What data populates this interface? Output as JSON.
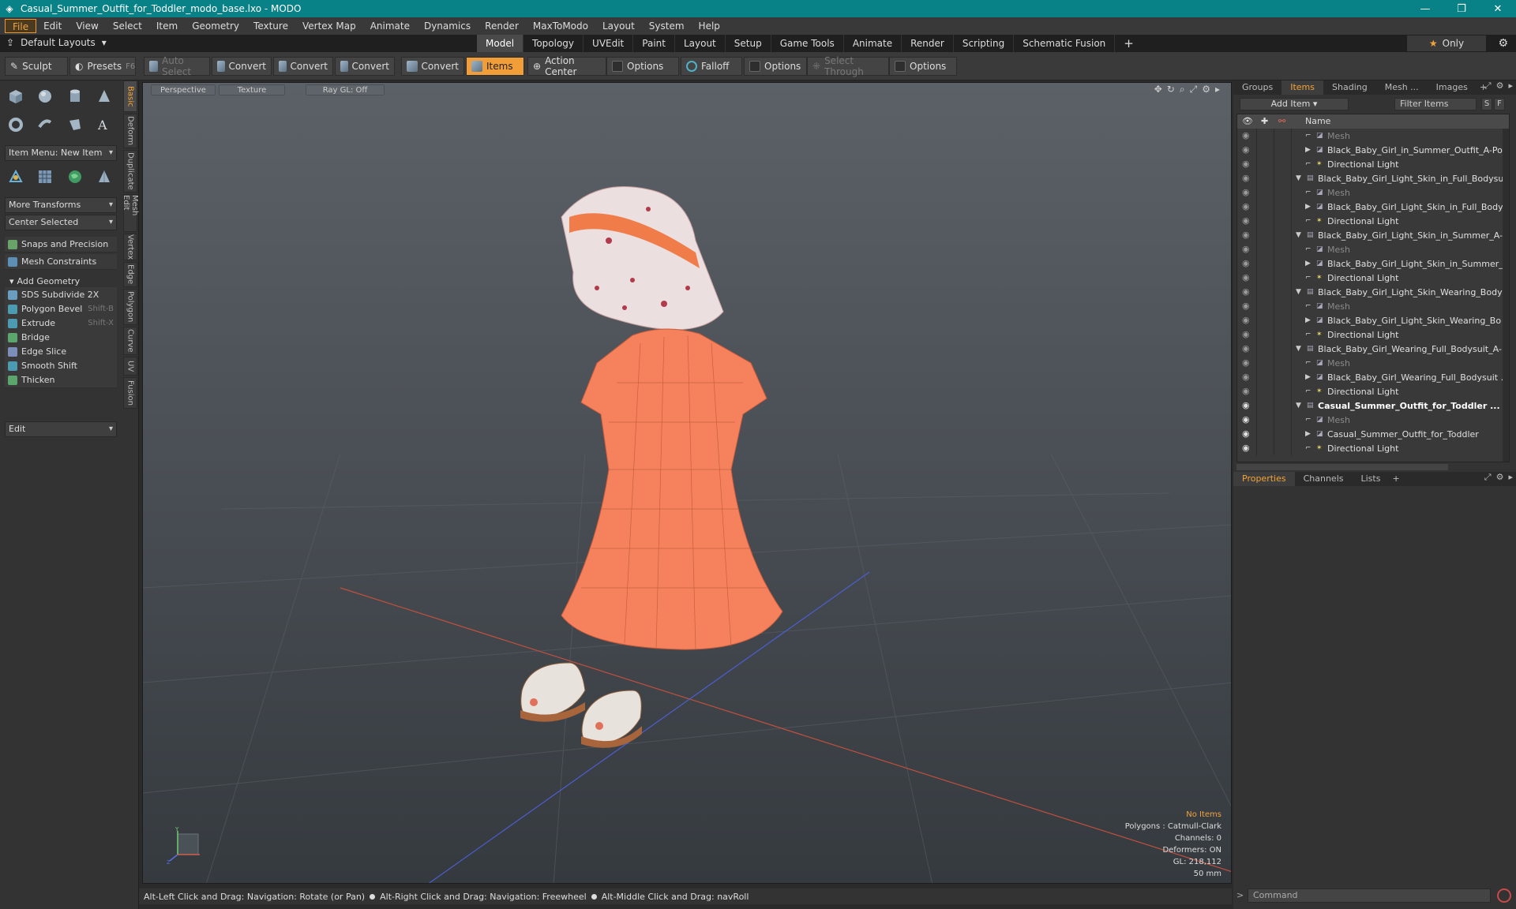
{
  "window": {
    "title": "Casual_Summer_Outfit_for_Toddler_modo_base.lxo - MODO",
    "controls": [
      "—",
      "❐",
      "✕"
    ]
  },
  "menu": [
    "File",
    "Edit",
    "View",
    "Select",
    "Item",
    "Geometry",
    "Texture",
    "Vertex Map",
    "Animate",
    "Dynamics",
    "Render",
    "MaxToModo",
    "Layout",
    "System",
    "Help"
  ],
  "layout_bar": {
    "layouts_label": "Default Layouts",
    "tabs": [
      "Model",
      "Topology",
      "UVEdit",
      "Paint",
      "Layout",
      "Setup",
      "Game Tools",
      "Animate",
      "Render",
      "Scripting",
      "Schematic Fusion",
      "+"
    ],
    "active_tab": "Model",
    "only_label": "Only"
  },
  "toolbar": {
    "sculpt": "Sculpt",
    "presets": "Presets",
    "presets_key": "F6",
    "auto_select": "Auto Select",
    "convert1": "Convert",
    "convert2": "Convert",
    "convert3": "Convert",
    "convert4": "Convert",
    "items": "Items",
    "action_center": "Action Center",
    "options1": "Options",
    "falloff": "Falloff",
    "options2": "Options",
    "select_through": "Select Through",
    "options3": "Options"
  },
  "left_panel": {
    "item_menu": "Item Menu: New Item",
    "more_transforms": "More Transforms",
    "center_selected": "Center Selected",
    "snaps": "Snaps and Precision",
    "mesh_constraints": "Mesh Constraints",
    "add_geometry": "Add Geometry",
    "tools": [
      {
        "label": "SDS Subdivide 2X",
        "key": "",
        "color": "#6a9ec0"
      },
      {
        "label": "Polygon Bevel",
        "key": "Shift-B",
        "color": "#4d9ab3"
      },
      {
        "label": "Extrude",
        "key": "Shift-X",
        "color": "#4d9ab3"
      },
      {
        "label": "Bridge",
        "key": "",
        "color": "#5aa66c"
      },
      {
        "label": "Edge Slice",
        "key": "",
        "color": "#7d8fb8"
      },
      {
        "label": "Smooth Shift",
        "key": "",
        "color": "#4d9ab3"
      },
      {
        "label": "Thicken",
        "key": "",
        "color": "#5aa66c"
      }
    ],
    "edit_dropdown": "Edit",
    "vtabs": [
      "Basic",
      "Deform",
      "Duplicate",
      "Mesh Edit",
      "Vertex",
      "Edge",
      "Polygon",
      "Curve",
      "UV",
      "Fusion"
    ]
  },
  "viewport": {
    "view_mode": "Perspective",
    "shading": "Texture",
    "raygl": "Ray GL: Off",
    "info": {
      "selection": "No Items",
      "polygons": "Polygons : Catmull-Clark",
      "channels": "Channels: 0",
      "deformers": "Deformers: ON",
      "gl": "GL: 218,112",
      "scale": "50 mm"
    },
    "colors": {
      "dress": "#f5825c",
      "hat_band": "#f07c4a",
      "hat": "#e9dede",
      "axis_x": "#c0503e",
      "axis_z": "#4c5ecf"
    }
  },
  "status_bar": [
    "Alt-Left Click and Drag: Navigation: Rotate (or Pan)",
    "Alt-Right Click and Drag: Navigation: Freewheel",
    "Alt-Middle Click and Drag: navRoll"
  ],
  "right_panel": {
    "top_tabs": [
      "Groups",
      "Items",
      "Shading",
      "Mesh ...",
      "Images",
      "+"
    ],
    "active_top": "Items",
    "add_item": "Add Item",
    "filter_items": "Filter Items",
    "filter_s": "S",
    "filter_f": "F",
    "tree_header": "Name",
    "tree": [
      {
        "label": "Mesh",
        "indent": 2,
        "arrow": "",
        "dim": true,
        "eye": false,
        "bold": false
      },
      {
        "label": "Black_Baby_Girl_in_Summer_Outfit_A-Pose",
        "indent": 2,
        "arrow": "▶",
        "dim": false,
        "eye": false,
        "bold": false
      },
      {
        "label": "Directional Light",
        "indent": 2,
        "arrow": "",
        "dim": false,
        "eye": false,
        "bold": false
      },
      {
        "label": "Black_Baby_Girl_Light_Skin_in_Full_Bodysu...",
        "indent": 1,
        "arrow": "▼",
        "dim": false,
        "eye": false,
        "bold": false
      },
      {
        "label": "Mesh",
        "indent": 2,
        "arrow": "",
        "dim": true,
        "eye": false,
        "bold": false
      },
      {
        "label": "Black_Baby_Girl_Light_Skin_in_Full_Body...",
        "indent": 2,
        "arrow": "▶",
        "dim": false,
        "eye": false,
        "bold": false
      },
      {
        "label": "Directional Light",
        "indent": 2,
        "arrow": "",
        "dim": false,
        "eye": false,
        "bold": false
      },
      {
        "label": "Black_Baby_Girl_Light_Skin_in_Summer_A- ...",
        "indent": 1,
        "arrow": "▼",
        "dim": false,
        "eye": false,
        "bold": false
      },
      {
        "label": "Mesh",
        "indent": 2,
        "arrow": "",
        "dim": true,
        "eye": false,
        "bold": false
      },
      {
        "label": "Black_Baby_Girl_Light_Skin_in_Summer_...",
        "indent": 2,
        "arrow": "▶",
        "dim": false,
        "eye": false,
        "bold": false
      },
      {
        "label": "Directional Light",
        "indent": 2,
        "arrow": "",
        "dim": false,
        "eye": false,
        "bold": false
      },
      {
        "label": "Black_Baby_Girl_Light_Skin_Wearing_Body ...",
        "indent": 1,
        "arrow": "▼",
        "dim": false,
        "eye": false,
        "bold": false
      },
      {
        "label": "Mesh",
        "indent": 2,
        "arrow": "",
        "dim": true,
        "eye": false,
        "bold": false
      },
      {
        "label": "Black_Baby_Girl_Light_Skin_Wearing_Bo ...",
        "indent": 2,
        "arrow": "▶",
        "dim": false,
        "eye": false,
        "bold": false
      },
      {
        "label": "Directional Light",
        "indent": 2,
        "arrow": "",
        "dim": false,
        "eye": false,
        "bold": false
      },
      {
        "label": "Black_Baby_Girl_Wearing_Full_Bodysuit_A-...",
        "indent": 1,
        "arrow": "▼",
        "dim": false,
        "eye": false,
        "bold": false
      },
      {
        "label": "Mesh",
        "indent": 2,
        "arrow": "",
        "dim": true,
        "eye": false,
        "bold": false
      },
      {
        "label": "Black_Baby_Girl_Wearing_Full_Bodysuit ...",
        "indent": 2,
        "arrow": "▶",
        "dim": false,
        "eye": false,
        "bold": false
      },
      {
        "label": "Directional Light",
        "indent": 2,
        "arrow": "",
        "dim": false,
        "eye": false,
        "bold": false
      },
      {
        "label": "Casual_Summer_Outfit_for_Toddler ...",
        "indent": 1,
        "arrow": "▼",
        "dim": false,
        "eye": true,
        "bold": true
      },
      {
        "label": "Mesh",
        "indent": 2,
        "arrow": "",
        "dim": true,
        "eye": true,
        "bold": false
      },
      {
        "label": "Casual_Summer_Outfit_for_Toddler",
        "indent": 2,
        "arrow": "▶",
        "dim": false,
        "eye": true,
        "bold": false
      },
      {
        "label": "Directional Light",
        "indent": 2,
        "arrow": "",
        "dim": false,
        "eye": true,
        "bold": false
      }
    ],
    "bottom_tabs": [
      "Properties",
      "Channels",
      "Lists",
      "+"
    ],
    "active_bottom": "Properties",
    "command_placeholder": "Command"
  }
}
